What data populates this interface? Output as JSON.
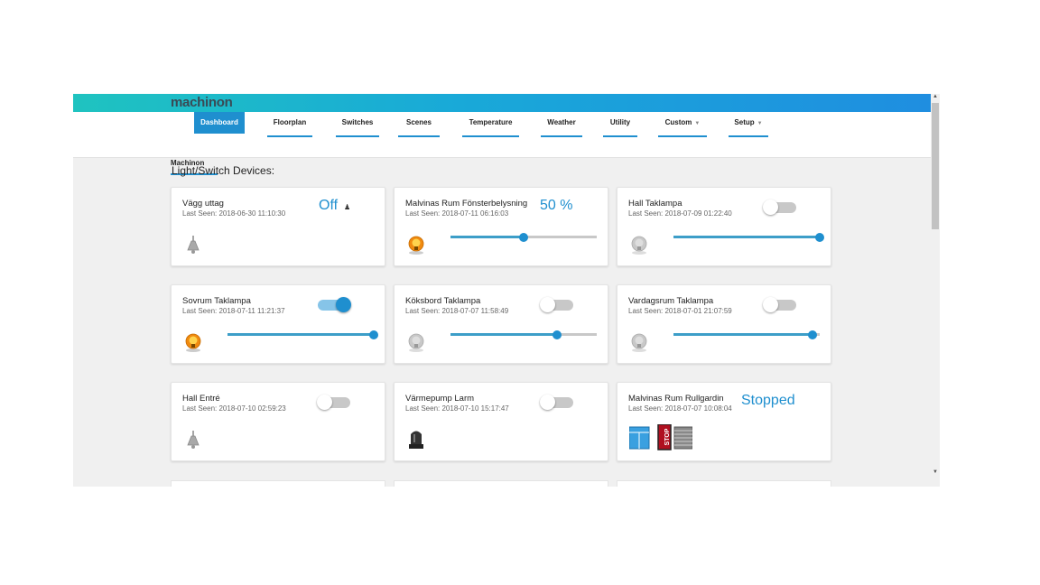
{
  "logo": "machinon",
  "nav": [
    {
      "label": "Dashboard",
      "active": true,
      "dropdown": false
    },
    {
      "label": "Floorplan",
      "active": false,
      "dropdown": false
    },
    {
      "label": "Switches",
      "active": false,
      "dropdown": false
    },
    {
      "label": "Scenes",
      "active": false,
      "dropdown": false
    },
    {
      "label": "Temperature",
      "active": false,
      "dropdown": false
    },
    {
      "label": "Weather",
      "active": false,
      "dropdown": false
    },
    {
      "label": "Utility",
      "active": false,
      "dropdown": false
    },
    {
      "label": "Custom",
      "active": false,
      "dropdown": true
    },
    {
      "label": "Setup",
      "active": false,
      "dropdown": true
    }
  ],
  "subnav": "Machinon",
  "section_title": "Light/Switch Devices:",
  "devices": [
    {
      "name": "Vägg uttag",
      "last_seen": "Last Seen: 2018-06-30 11:10:30",
      "status": "Off",
      "type": "text",
      "icon": "lamp-icon"
    },
    {
      "name": "Malvinas Rum Fönsterbelysning",
      "last_seen": "Last Seen: 2018-07-11 06:16:03",
      "status": "50 %",
      "type": "dimmer-text",
      "level": 0.5,
      "icon": "bulb-on-icon"
    },
    {
      "name": "Hall Taklampa",
      "last_seen": "Last Seen: 2018-07-09 01:22:40",
      "type": "dimmer",
      "on": false,
      "level": 1.0,
      "icon": "bulb-off-icon"
    },
    {
      "name": "Sovrum Taklampa",
      "last_seen": "Last Seen: 2018-07-11 11:21:37",
      "type": "dimmer",
      "on": true,
      "level": 1.0,
      "icon": "bulb-on-icon"
    },
    {
      "name": "Köksbord Taklampa",
      "last_seen": "Last Seen: 2018-07-07 11:58:49",
      "type": "dimmer",
      "on": false,
      "level": 0.73,
      "icon": "bulb-off-icon"
    },
    {
      "name": "Vardagsrum Taklampa",
      "last_seen": "Last Seen: 2018-07-01 21:07:59",
      "type": "dimmer",
      "on": false,
      "level": 0.95,
      "icon": "bulb-off-icon"
    },
    {
      "name": "Hall Entré",
      "last_seen": "Last Seen: 2018-07-10 02:59:23",
      "type": "switch",
      "on": false,
      "icon": "lamp-icon"
    },
    {
      "name": "Värmepump Larm",
      "last_seen": "Last Seen: 2018-07-10 15:17:47",
      "type": "switch",
      "on": false,
      "icon": "siren-icon"
    },
    {
      "name": "Malvinas Rum Rullgardin",
      "last_seen": "Last Seen: 2018-07-07 10:08:04",
      "status": "Stopped",
      "type": "blind",
      "icon": "blinds-icon"
    }
  ],
  "colors": {
    "accent": "#1f8fcf",
    "arrow": "#e0242b"
  }
}
